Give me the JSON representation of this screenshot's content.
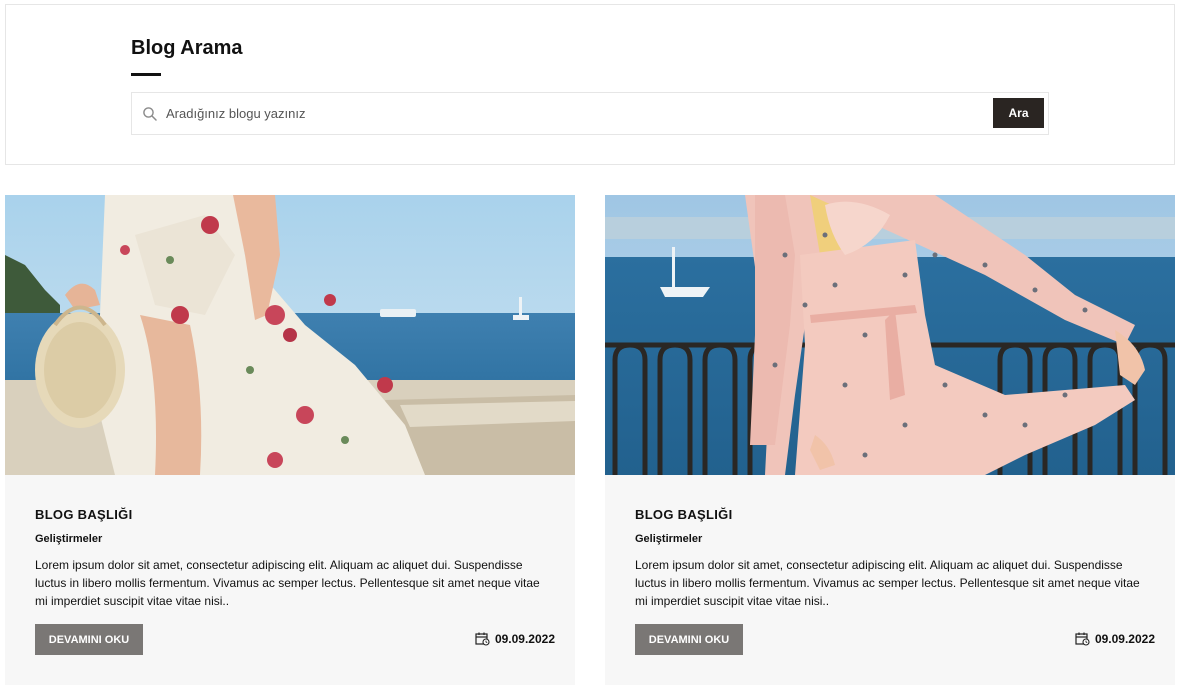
{
  "search": {
    "title": "Blog Arama",
    "placeholder": "Aradığınız blogu yazınız",
    "button_label": "Ara",
    "icon": "search-icon"
  },
  "posts": [
    {
      "title": "BLOG BAŞLIĞI",
      "category": "Geliştirmeler",
      "excerpt": "Lorem ipsum dolor sit amet, consectetur adipiscing elit. Aliquam ac aliquet dui. Suspendisse luctus in libero mollis fermentum. Vivamus ac semper lectus. Pellentesque sit amet neque vitae mi imperdiet suscipit vitae vitae nisi..",
      "read_more_label": "DEVAMINI OKU",
      "date": "09.09.2022",
      "date_icon": "calendar-icon"
    },
    {
      "title": "BLOG BAŞLIĞI",
      "category": "Geliştirmeler",
      "excerpt": "Lorem ipsum dolor sit amet, consectetur adipiscing elit. Aliquam ac aliquet dui. Suspendisse luctus in libero mollis fermentum. Vivamus ac semper lectus. Pellentesque sit amet neque vitae mi imperdiet suscipit vitae vitae nisi..",
      "read_more_label": "DEVAMINI OKU",
      "date": "09.09.2022",
      "date_icon": "calendar-icon"
    }
  ],
  "colors": {
    "button_dark": "#2a2522",
    "button_grey": "#7a7775",
    "card_background": "#f7f7f7"
  }
}
